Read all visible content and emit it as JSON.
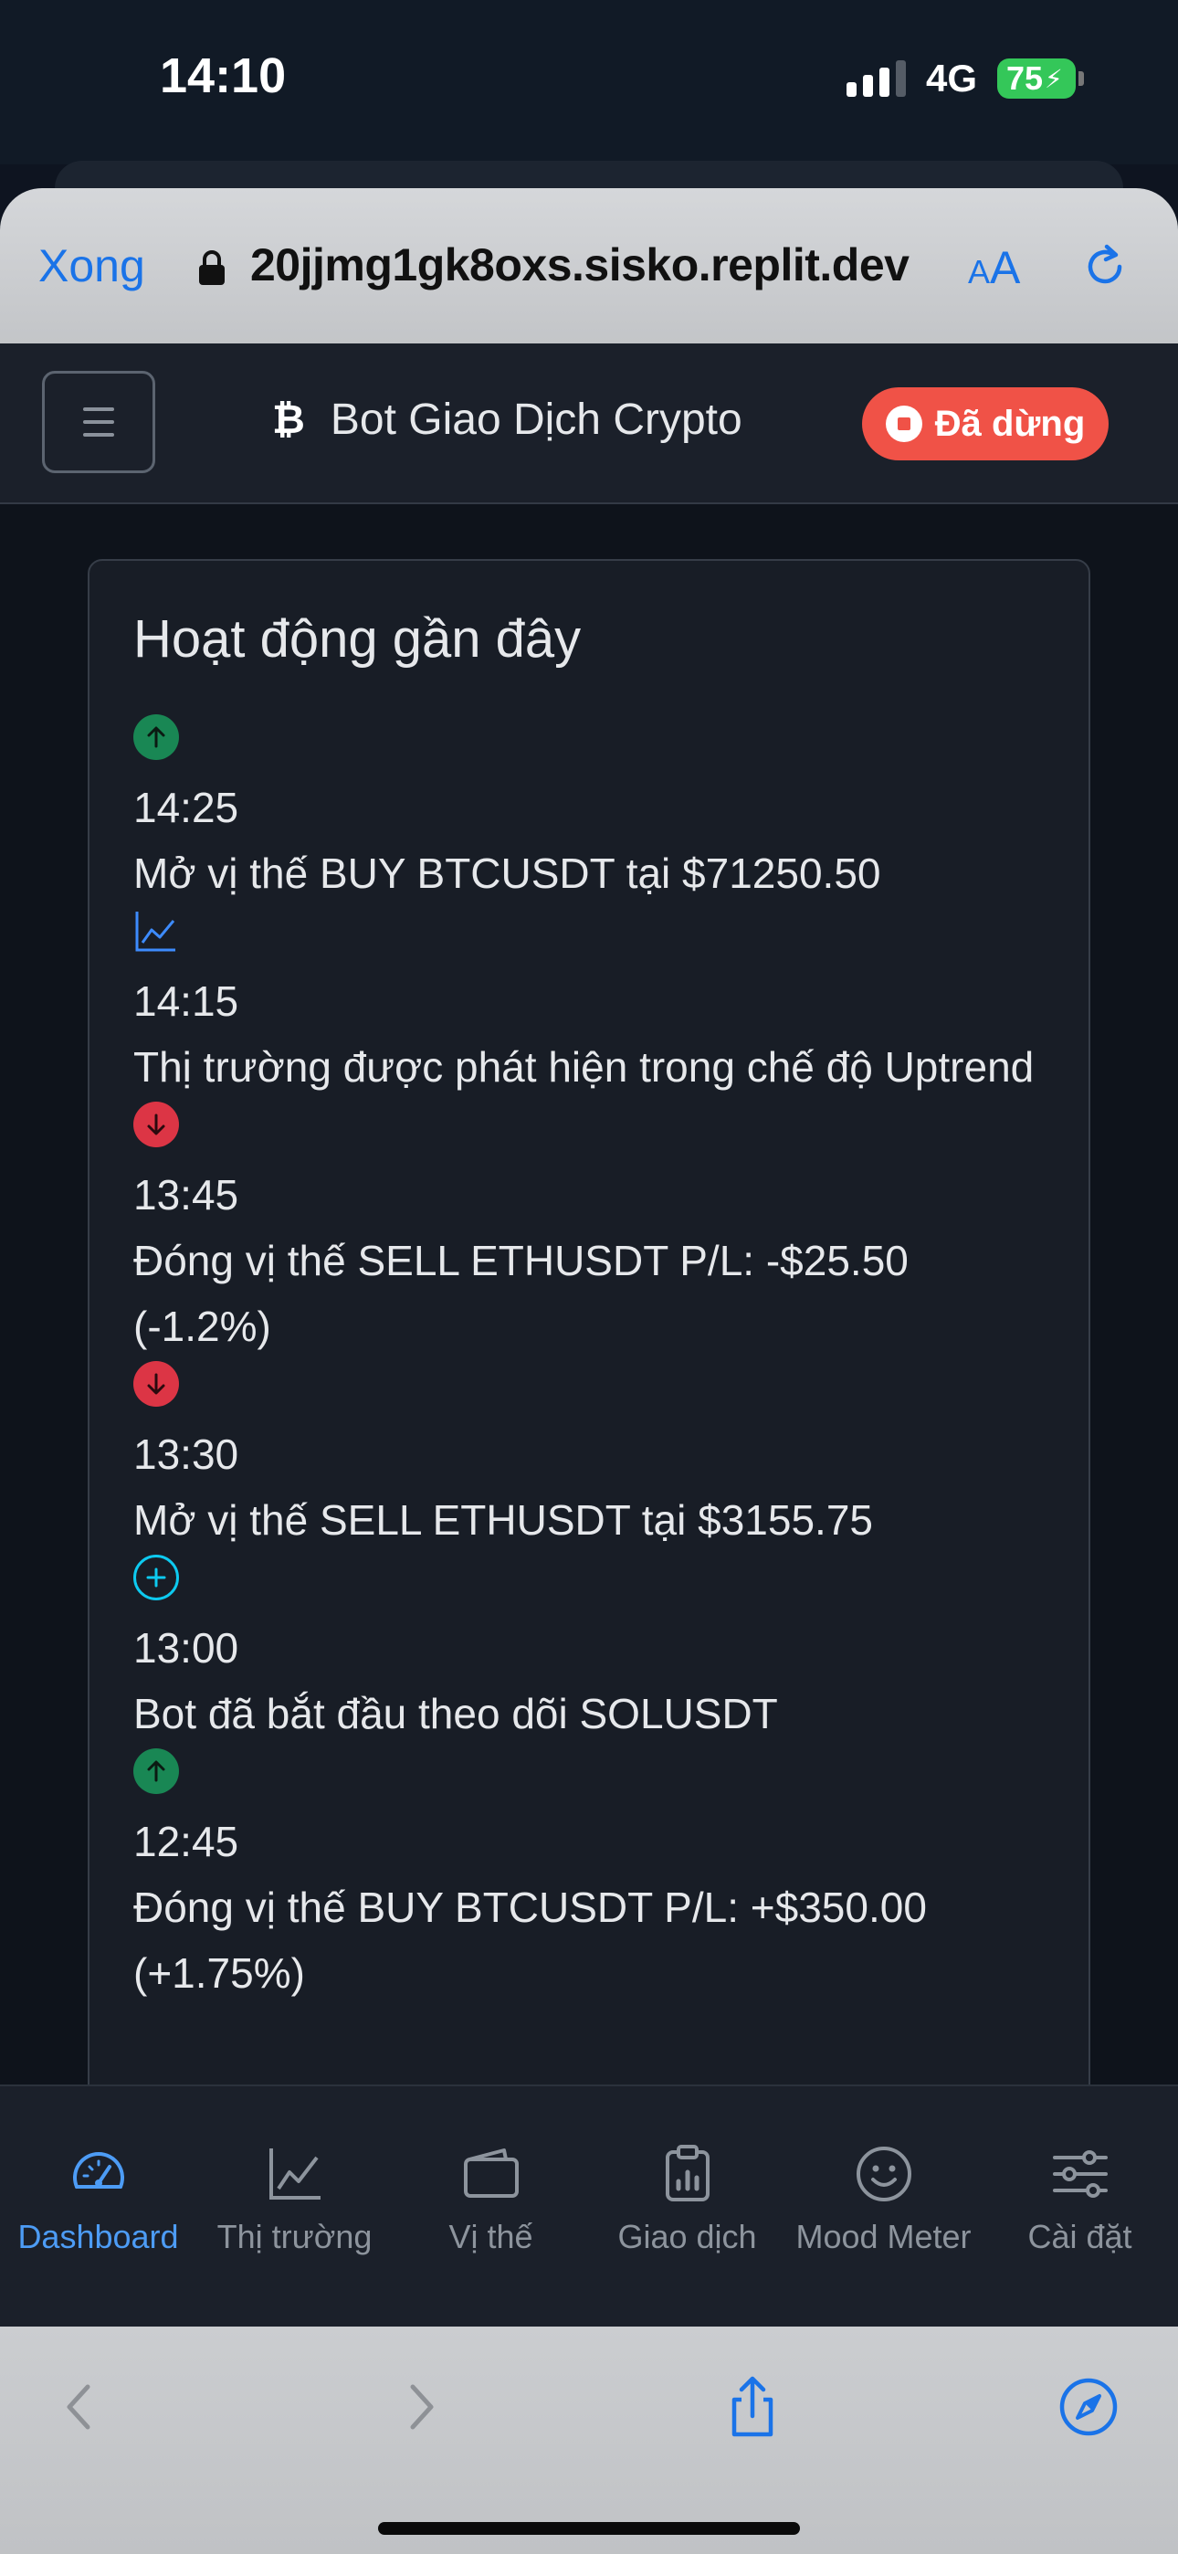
{
  "status_bar": {
    "time": "14:10",
    "network": "4G",
    "battery": "75"
  },
  "browser": {
    "done_label": "Xong",
    "url": "20jjmg1gk8oxs.sisko.replit.dev",
    "aa_small": "A",
    "aa_big": "A"
  },
  "navbar": {
    "title": "Bot Giao Dịch Crypto",
    "status_badge": "Đã dừng"
  },
  "card": {
    "title": "Hoạt động gần đây",
    "activities": [
      {
        "icon": "arrow-up-icon",
        "time": "14:25",
        "text": "Mở vị thế BUY BTCUSDT tại $71250.50"
      },
      {
        "icon": "chart-line-icon",
        "time": "14:15",
        "text": "Thị trường được phát hiện trong chế độ Uptrend"
      },
      {
        "icon": "arrow-down-icon",
        "time": "13:45",
        "text": "Đóng vị thế SELL ETHUSDT P/L: -$25.50 (-1.2%)"
      },
      {
        "icon": "arrow-down-icon",
        "time": "13:30",
        "text": "Mở vị thế SELL ETHUSDT tại $3155.75"
      },
      {
        "icon": "plus-circle-icon",
        "time": "13:00",
        "text": "Bot đã bắt đầu theo dõi SOLUSDT"
      },
      {
        "icon": "arrow-up-icon",
        "time": "12:45",
        "text": "Đóng vị thế BUY BTCUSDT P/L: +$350.00 (+1.75%)"
      }
    ]
  },
  "tabs": [
    {
      "label": "Dashboard",
      "icon": "speedometer-icon",
      "active": true
    },
    {
      "label": "Thị trường",
      "icon": "chart-line-icon",
      "active": false
    },
    {
      "label": "Vị thế",
      "icon": "wallet-icon",
      "active": false
    },
    {
      "label": "Giao dịch",
      "icon": "clipboard-data-icon",
      "active": false
    },
    {
      "label": "Mood Meter",
      "icon": "smile-icon",
      "active": false
    },
    {
      "label": "Cài đặt",
      "icon": "sliders-icon",
      "active": false
    }
  ],
  "colors": {
    "accent": "#4d9cf5",
    "up": "#198754",
    "down": "#dc3545",
    "info": "#0dcaf0",
    "stopped": "#f05247"
  }
}
